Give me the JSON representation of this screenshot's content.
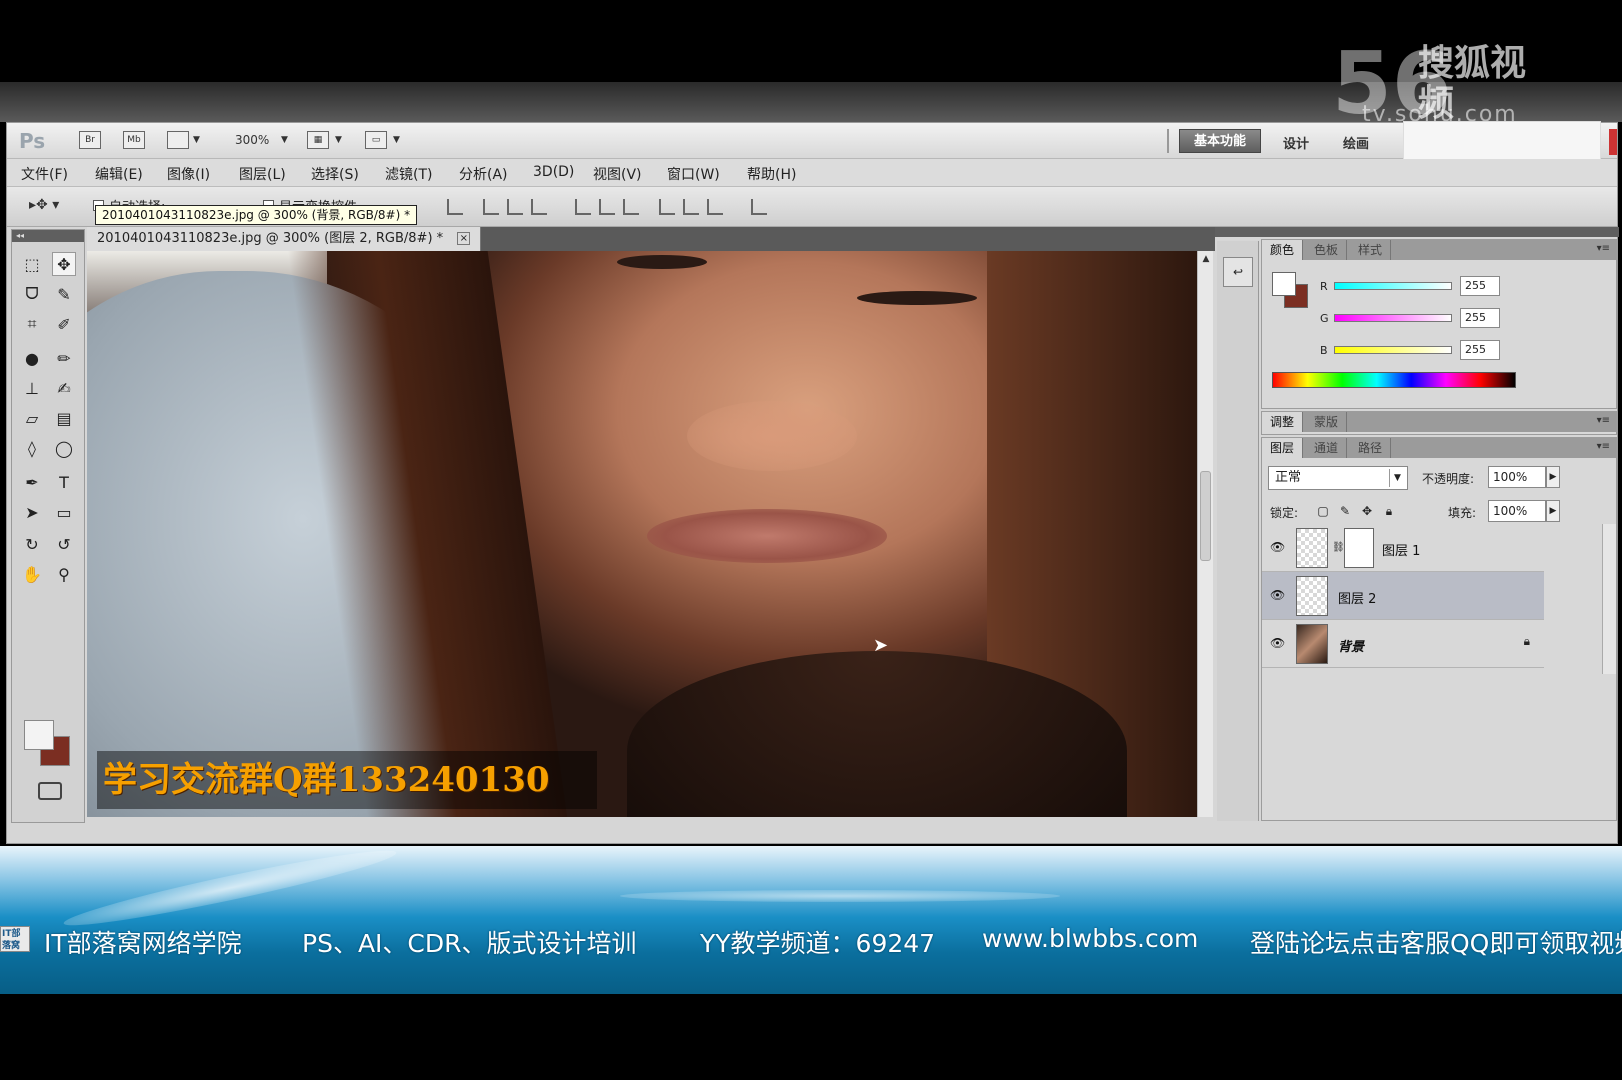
{
  "watermark": {
    "logo_number": "56",
    "brand": "搜狐视频",
    "url": "tv.sohu.com"
  },
  "appbar": {
    "ps_logo": "Ps",
    "zoom": "300%",
    "br_icon": "Br",
    "mb_icon": "Mb",
    "workspaces": {
      "active": "基本功能",
      "items": [
        "设计",
        "绘画"
      ]
    }
  },
  "menubar": {
    "items": [
      "文件(F)",
      "编辑(E)",
      "图像(I)",
      "图层(L)",
      "选择(S)",
      "滤镜(T)",
      "分析(A)",
      "3D(D)",
      "视图(V)",
      "窗口(W)",
      "帮助(H)"
    ]
  },
  "options": {
    "auto_select_label": "自动选择:",
    "show_transform_label": "显示变换控件"
  },
  "tooltip": "2010401043110823e.jpg @ 300% (背景, RGB/8#) *",
  "document": {
    "tab_label": "2010401043110823e.jpg @ 300% (图层 2, RGB/8#) *",
    "close_glyph": "×",
    "overlay_text": "学习交流群Q群133240130"
  },
  "color_panel": {
    "tabs": [
      "颜色",
      "色板",
      "样式"
    ],
    "channels": [
      {
        "label": "R",
        "value": "255"
      },
      {
        "label": "G",
        "value": "255"
      },
      {
        "label": "B",
        "value": "255"
      }
    ],
    "foreground": "#ffffff",
    "background": "#7b2e22"
  },
  "adjust_panel": {
    "tabs": [
      "调整",
      "蒙版"
    ]
  },
  "layers_panel": {
    "tabs": [
      "图层",
      "通道",
      "路径"
    ],
    "blend_mode": "正常",
    "opacity_label": "不透明度:",
    "opacity_value": "100%",
    "lock_label": "锁定:",
    "fill_label": "填充:",
    "fill_value": "100%",
    "layers": [
      {
        "name": "图层 1",
        "selected": false
      },
      {
        "name": "图层 2",
        "selected": true
      },
      {
        "name": "背景",
        "selected": false
      }
    ]
  },
  "footer": {
    "logo": "IT部落窝",
    "items": [
      "IT部落窝网络学院",
      "PS、AI、CDR、版式设计培训",
      "YY教学频道：69247",
      "www.blwbbs.com",
      "登陆论坛点击客服QQ即可领取视频教程"
    ]
  }
}
